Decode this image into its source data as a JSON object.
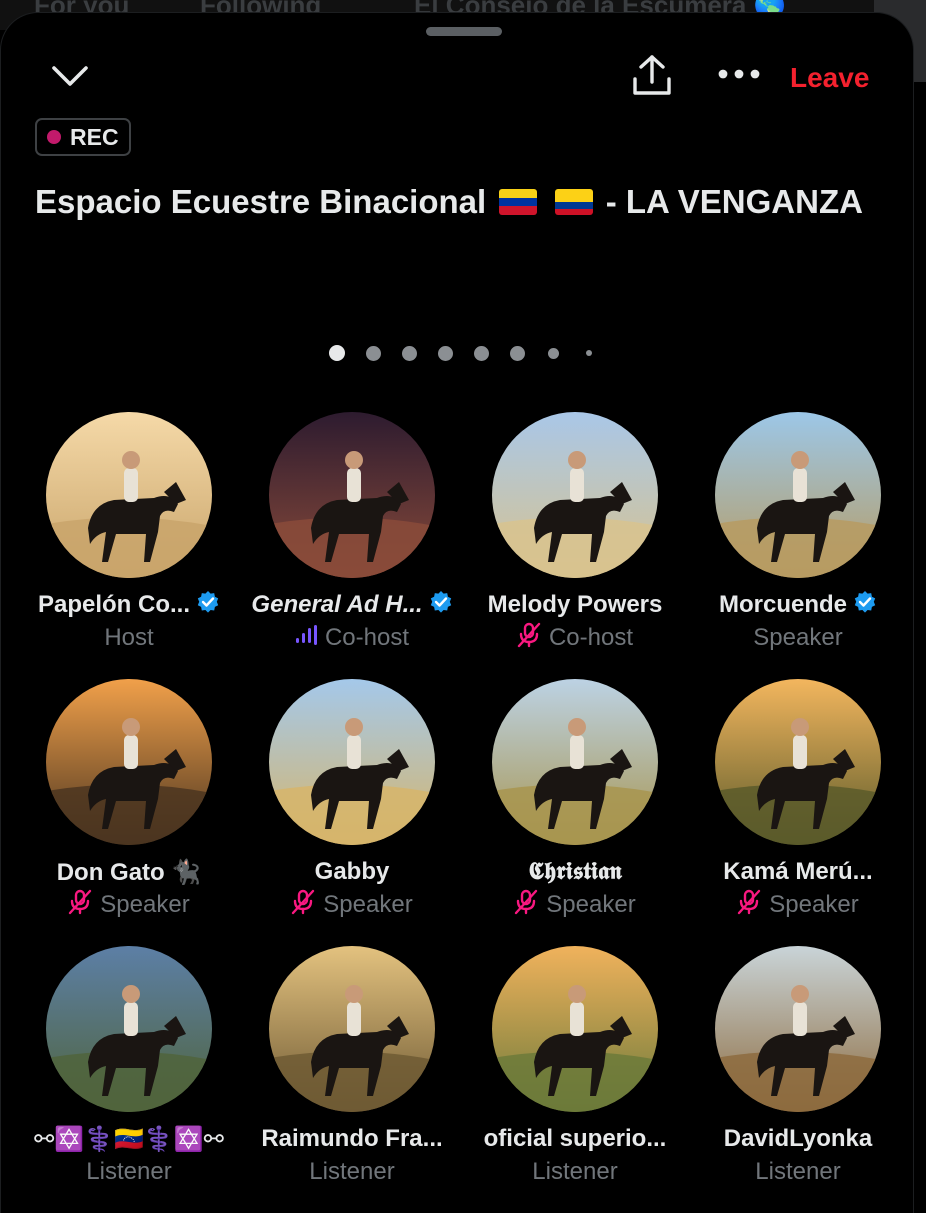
{
  "background_tabs": [
    "For you",
    "Following",
    "El Consejo de la Escúmera 🌎"
  ],
  "header": {
    "collapse_icon": "chevron-down-icon",
    "share_icon": "share-icon",
    "more_icon": "more-icon",
    "leave_label": "Leave"
  },
  "rec": {
    "label": "REC",
    "color": "#c21a6b"
  },
  "space": {
    "title_before_flags": "Espacio Ecuestre Binacional",
    "title_after_flags": "- LA VENGANZA",
    "flags": [
      "venezuela-flag",
      "colombia-flag"
    ]
  },
  "pagination": {
    "pages": 8,
    "current": 1
  },
  "colors": {
    "accent_red": "#f4212e",
    "verified_blue": "#1d9bf0",
    "muted_pink": "#f91880",
    "cohost_purple": "#7856ff",
    "muted_text": "#71767b"
  },
  "participants": [
    {
      "name": "Papelón Co...",
      "verified": true,
      "role": "Host",
      "status": "none",
      "bg": [
        "#f5d9a8",
        "#c9a56b"
      ]
    },
    {
      "name": "General Ad H...",
      "verified": true,
      "role": "Co-host",
      "status": "speaking",
      "bg": [
        "#2d1b2f",
        "#8a4b3a"
      ]
    },
    {
      "name": "Melody Powers",
      "verified": false,
      "role": "Co-host",
      "status": "muted",
      "bg": [
        "#a9c7e8",
        "#d8c38e"
      ]
    },
    {
      "name": "Morcuende",
      "verified": true,
      "role": "Speaker",
      "status": "none",
      "bg": [
        "#9cc7e8",
        "#b79b61"
      ]
    },
    {
      "name": "Don Gato 🐈‍⬛",
      "verified": false,
      "role": "Speaker",
      "status": "muted",
      "bg": [
        "#f1a04a",
        "#4b3520"
      ]
    },
    {
      "name": "Gabby",
      "verified": false,
      "role": "Speaker",
      "status": "muted",
      "bg": [
        "#a4c8ea",
        "#d6b56b"
      ]
    },
    {
      "name": "𝕮𝖍𝖗𝖎𝖘𝖙𝖎𝖆𝖓",
      "verified": false,
      "role": "Speaker",
      "status": "muted",
      "bg": [
        "#bcd2e4",
        "#a8954f"
      ]
    },
    {
      "name": "Kamá Merú...",
      "verified": false,
      "role": "Speaker",
      "status": "muted",
      "bg": [
        "#f3b65e",
        "#5a5a2a"
      ]
    },
    {
      "name": "⚯✡️⚕️🇻🇪⚕️✡️⚯",
      "verified": false,
      "role": "Listener",
      "status": "none",
      "bg": [
        "#5c7fa6",
        "#50643c"
      ]
    },
    {
      "name": "Raimundo Fra...",
      "verified": false,
      "role": "Listener",
      "status": "none",
      "bg": [
        "#e3c27f",
        "#6f5a34"
      ]
    },
    {
      "name": "oficial superio...",
      "verified": false,
      "role": "Listener",
      "status": "none",
      "bg": [
        "#f0b25c",
        "#6c7a3a"
      ]
    },
    {
      "name": "DavidLyonka",
      "verified": false,
      "role": "Listener",
      "status": "none",
      "bg": [
        "#c9d4d8",
        "#8d6b3e"
      ]
    }
  ]
}
